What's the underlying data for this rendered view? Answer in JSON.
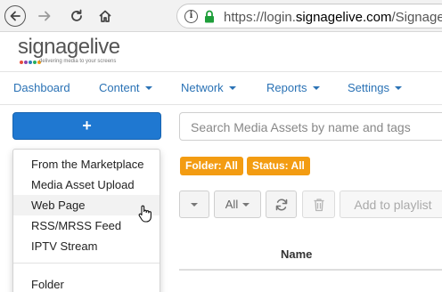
{
  "browser": {
    "url_prefix": "https://login.",
    "url_domain": "signagelive.com",
    "url_path": "/Signage",
    "icons": [
      "back-icon",
      "forward-icon",
      "reload-icon",
      "home-icon",
      "info-icon",
      "lock-icon"
    ]
  },
  "logo": {
    "word": "signagelive",
    "tagline": "delivering media to your screens",
    "dot_colors": [
      "#e74c3c",
      "#8e44ad",
      "#2980b9",
      "#27ae60",
      "#f39c12"
    ]
  },
  "menu": {
    "dashboard": "Dashboard",
    "content": "Content",
    "network": "Network",
    "reports": "Reports",
    "settings": "Settings"
  },
  "add_button": {
    "label": "+"
  },
  "dropdown": {
    "items": [
      "From the Marketplace",
      "Media Asset Upload",
      "Web Page",
      "RSS/MRSS Feed",
      "IPTV Stream"
    ],
    "hovered": "Web Page",
    "folder": "Folder"
  },
  "search": {
    "placeholder": "Search Media Assets by name and tags"
  },
  "filters": {
    "folder": "Folder: All",
    "status": "Status: All"
  },
  "toolbar": {
    "filter_select": "All",
    "add_to_playlist": "Add to playlist",
    "icons": [
      "caret-down-icon",
      "refresh-icon",
      "trash-icon"
    ]
  },
  "table": {
    "name_header": "Name"
  },
  "colors": {
    "accent": "#1f78d1",
    "menu_link": "#2a72b5",
    "badge": "#f39c12",
    "lock": "#1e9e3a"
  }
}
